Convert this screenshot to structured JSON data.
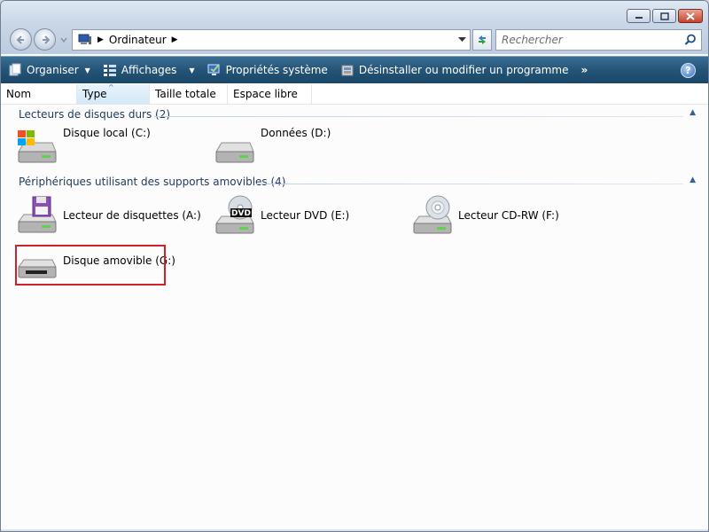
{
  "address": {
    "crumb": "Ordinateur",
    "separator": "▶"
  },
  "search": {
    "placeholder": "Rechercher"
  },
  "toolbar": {
    "organize": "Organiser",
    "views": "Affichages",
    "system_props": "Propriétés système",
    "uninstall": "Désinstaller ou modifier un programme",
    "more": "»",
    "help": "?"
  },
  "columns": [
    "Nom",
    "Type",
    "Taille totale",
    "Espace libre"
  ],
  "groups": [
    {
      "label": "Lecteurs de disques durs (2)",
      "items": [
        {
          "label": "Disque local (C:)",
          "icon": "hard-drive-windows-icon"
        },
        {
          "label": "Données (D:)",
          "icon": "hard-drive-icon"
        }
      ]
    },
    {
      "label": "Périphériques utilisant des supports amovibles (4)",
      "items": [
        {
          "label": "Lecteur de disquettes (A:)",
          "icon": "floppy-drive-icon"
        },
        {
          "label": "Lecteur DVD (E:)",
          "icon": "dvd-drive-icon"
        },
        {
          "label": "Lecteur CD-RW (F:)",
          "icon": "cd-drive-icon"
        },
        {
          "label": "Disque amovible (G:)",
          "icon": "removable-disk-icon"
        }
      ]
    }
  ],
  "dvd_badge": "DVD",
  "colors": {
    "toolbar": "#245477",
    "group_header": "#1e395b",
    "highlight": "#d0202a"
  }
}
